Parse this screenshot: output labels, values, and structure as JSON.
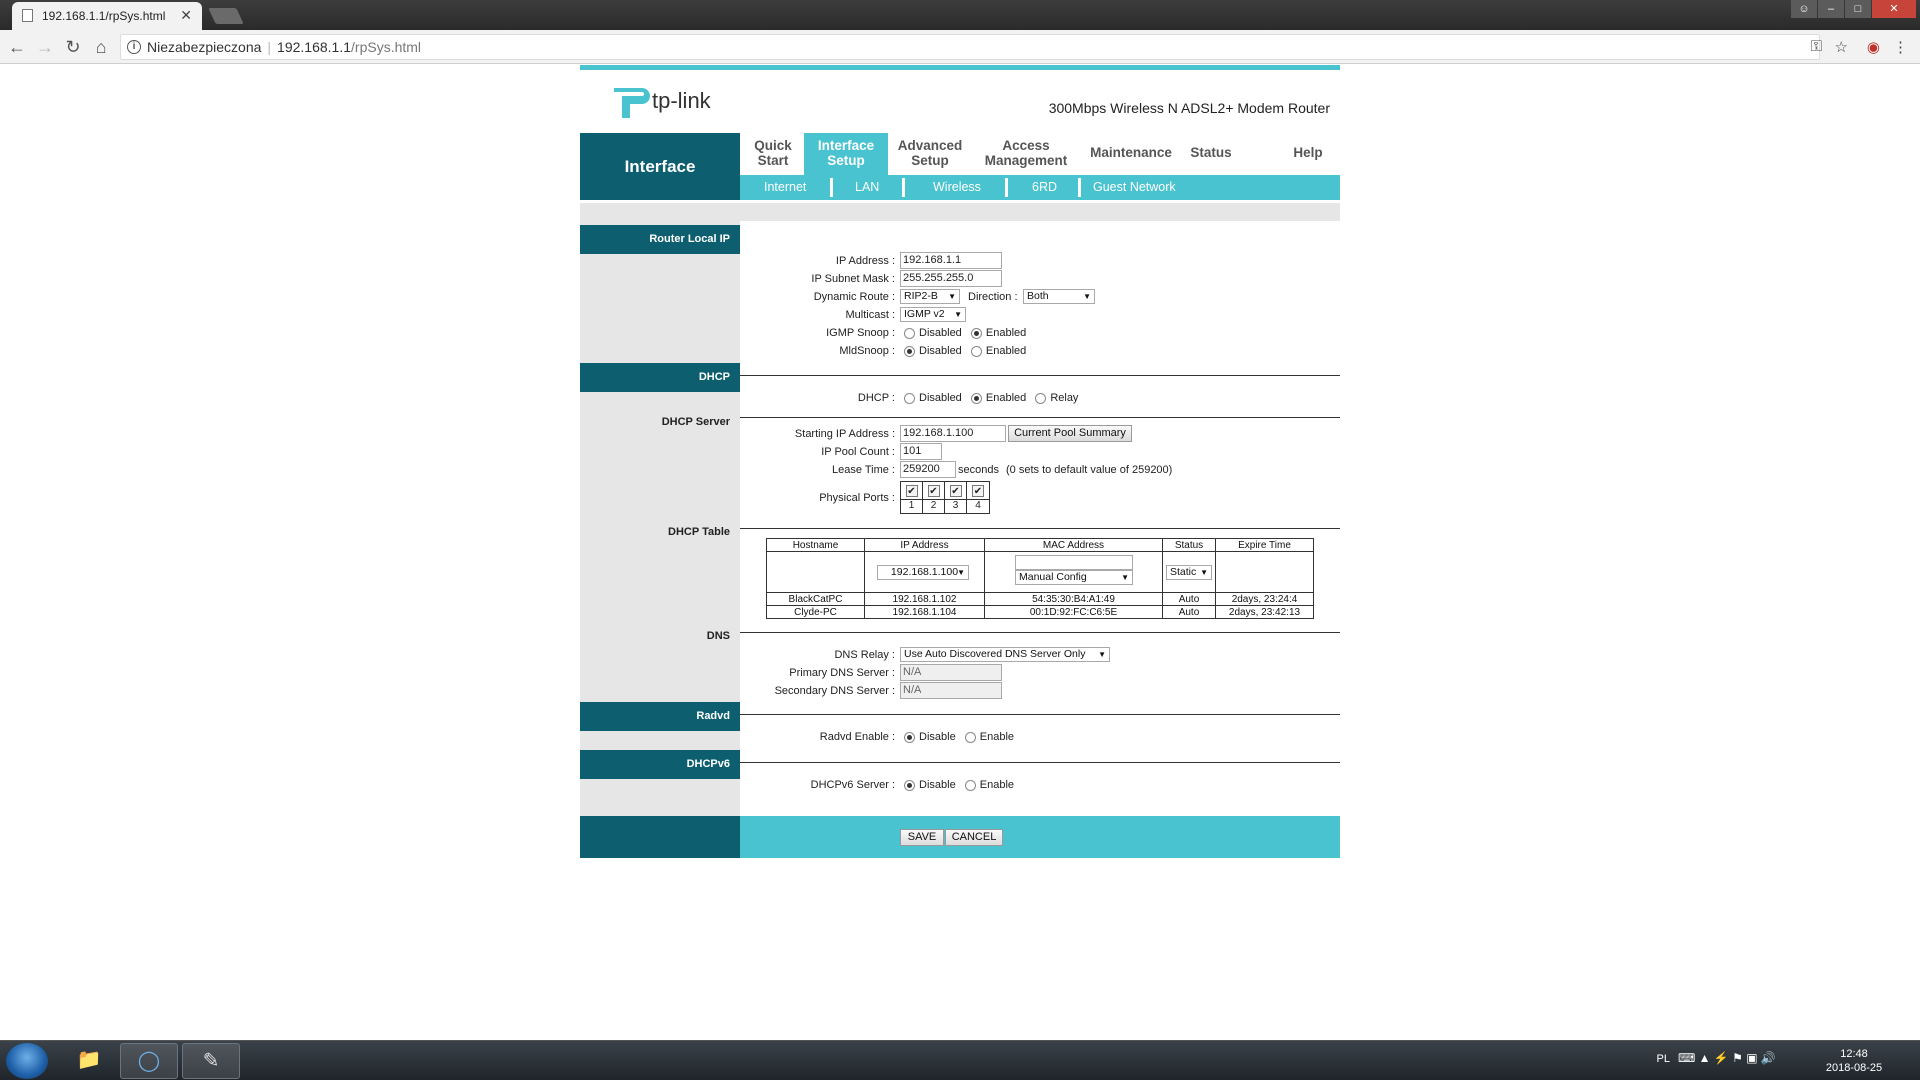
{
  "browser": {
    "tab_title": "192.168.1.1/rpSys.html",
    "tab_close": "✕",
    "security_label": "Niezabezpieczona",
    "url_host": "192.168.1.1",
    "url_path": "/rpSys.html"
  },
  "header": {
    "brand": "tp-link",
    "model": "300Mbps Wireless N ADSL2+ Modem Router"
  },
  "nav": {
    "section_title": "Interface",
    "menu": [
      {
        "line1": "Quick",
        "line2": "Start"
      },
      {
        "line1": "Interface",
        "line2": "Setup",
        "active": true
      },
      {
        "line1": "Advanced",
        "line2": "Setup"
      },
      {
        "line1": "Access",
        "line2": "Management"
      },
      {
        "line1": "Maintenance",
        "line2": ""
      },
      {
        "line1": "Status",
        "line2": ""
      },
      {
        "line1": "Help",
        "line2": ""
      }
    ],
    "submenu": [
      "Internet",
      "LAN",
      "Wireless",
      "6RD",
      "Guest Network"
    ]
  },
  "router_local_ip": {
    "section": "Router Local IP",
    "ip_address_label": "IP Address :",
    "ip_address": "192.168.1.1",
    "subnet_label": "IP Subnet Mask :",
    "subnet": "255.255.255.0",
    "dynamic_route_label": "Dynamic Route :",
    "dynamic_route": "RIP2-B",
    "direction_label": "Direction :",
    "direction": "Both",
    "multicast_label": "Multicast :",
    "multicast": "IGMP v2",
    "igmp_snoop_label": "IGMP Snoop :",
    "mld_snoop_label": "MldSnoop :",
    "opt_disabled": "Disabled",
    "opt_enabled": "Enabled"
  },
  "dhcp": {
    "section": "DHCP",
    "dhcp_label": "DHCP :",
    "opt_disabled": "Disabled",
    "opt_enabled": "Enabled",
    "opt_relay": "Relay",
    "server_section": "DHCP Server",
    "start_ip_label": "Starting IP Address :",
    "start_ip": "192.168.1.100",
    "pool_summary_button": "Current Pool Summary",
    "pool_count_label": "IP Pool Count :",
    "pool_count": "101",
    "lease_label": "Lease Time :",
    "lease": "259200",
    "lease_unit": "seconds",
    "lease_note": "(0 sets to default value of 259200)",
    "ports_label": "Physical Ports :",
    "ports": [
      "1",
      "2",
      "3",
      "4"
    ],
    "check_mark": "✔",
    "table_section": "DHCP Table",
    "table_headers": [
      "Hostname",
      "IP Address",
      "MAC Address",
      "Status",
      "Expire Time"
    ],
    "edit_ip": "192.168.1.100",
    "edit_mac_mode": "Manual Config",
    "edit_status": "Static",
    "table_rows": [
      [
        "BlackCatPC",
        "192.168.1.102",
        "54:35:30:B4:A1:49",
        "Auto",
        "2days, 23:24:4"
      ],
      [
        "Clyde-PC",
        "192.168.1.104",
        "00:1D:92:FC:C6:5E",
        "Auto",
        "2days, 23:42:13"
      ]
    ]
  },
  "dns": {
    "section": "DNS",
    "relay_label": "DNS Relay :",
    "relay": "Use Auto Discovered DNS Server Only",
    "primary_label": "Primary DNS Server :",
    "primary": "N/A",
    "secondary_label": "Secondary DNS Server :",
    "secondary": "N/A"
  },
  "radvd": {
    "section": "Radvd",
    "label": "Radvd Enable :",
    "opt_disable": "Disable",
    "opt_enable": "Enable"
  },
  "dhcpv6": {
    "section": "DHCPv6",
    "label": "DHCPv6 Server :",
    "opt_disable": "Disable",
    "opt_enable": "Enable"
  },
  "actions": {
    "save": "SAVE",
    "cancel": "CANCEL"
  },
  "taskbar": {
    "lang": "PL",
    "time": "12:48",
    "date": "2018-08-25"
  },
  "colors": {
    "accent": "#4ac3d0",
    "dark": "#0d5f6f"
  }
}
